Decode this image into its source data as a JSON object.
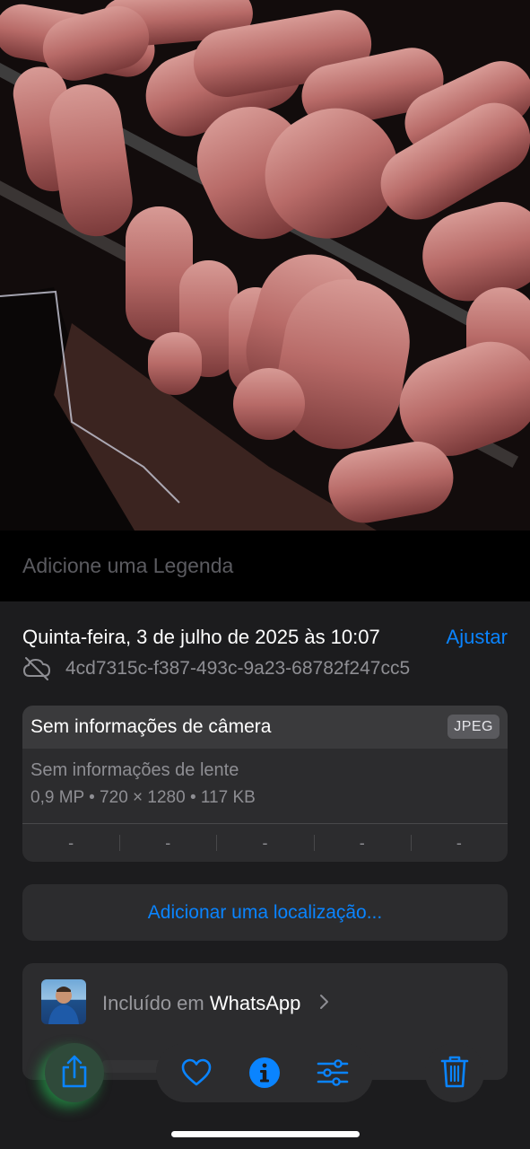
{
  "photo": {
    "description_icon": "photo-image"
  },
  "caption": {
    "placeholder": "Adicione uma Legenda"
  },
  "info": {
    "date": "Quinta-feira, 3 de julho de 2025 às 10:07",
    "adjust_label": "Ajustar",
    "cloud_icon": "cloud-slash-icon",
    "uuid": "4cd7315c-f387-493c-9a23-68782f247cc5"
  },
  "camera": {
    "title": "Sem informações de câmera",
    "format": "JPEG",
    "lens": "Sem informações de lente",
    "specs": "0,9 MP  •  720 × 1280  •  117 KB",
    "exif": [
      "-",
      "-",
      "-",
      "-",
      "-"
    ]
  },
  "location": {
    "label": "Adicionar uma localização..."
  },
  "album": {
    "prefix": "Incluído em ",
    "app": "WhatsApp"
  },
  "toolbar": {
    "share_icon": "share-icon",
    "favorite_icon": "heart-icon",
    "info_icon": "info-icon",
    "adjust_icon": "sliders-icon",
    "delete_icon": "trash-icon"
  },
  "colors": {
    "accent": "#0a84ff",
    "background": "#1c1c1e",
    "card": "#2c2c2e"
  }
}
